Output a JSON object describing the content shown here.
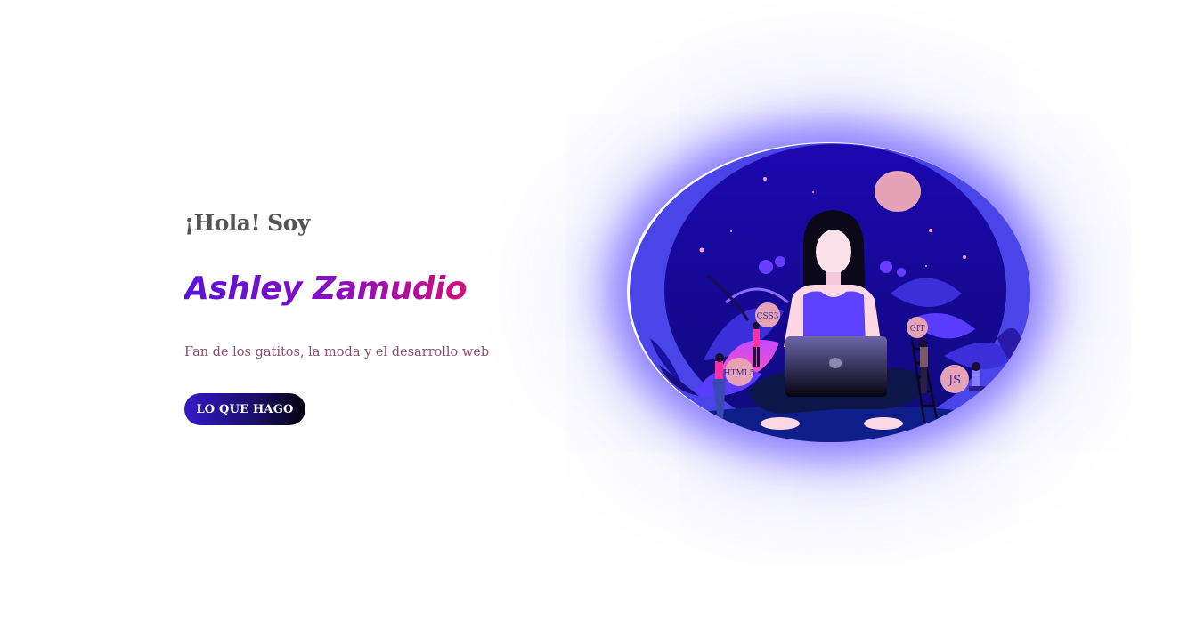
{
  "hero": {
    "greeting": "¡Hola! Soy",
    "name": "Ashley Zamudio",
    "tagline": "Fan de los gatitos, la moda y el desarrollo web",
    "cta_label": "LO QUE HAGO"
  },
  "illustration": {
    "badges": {
      "css": "CSS3",
      "html": "HTML5",
      "git": "GIT",
      "js": "JS"
    }
  },
  "colors": {
    "greeting": "#555555",
    "name_gradient": [
      "#5a12d8",
      "#8a0fc0",
      "#d0107f"
    ],
    "tagline": "#8c4a6e",
    "button_gradient": [
      "#3419c6",
      "#1b0f6e",
      "#05030e"
    ],
    "illustration_outer": "#4a45e8",
    "illustration_sky": "#1a0aa8",
    "moon": "#e6a3b8"
  }
}
